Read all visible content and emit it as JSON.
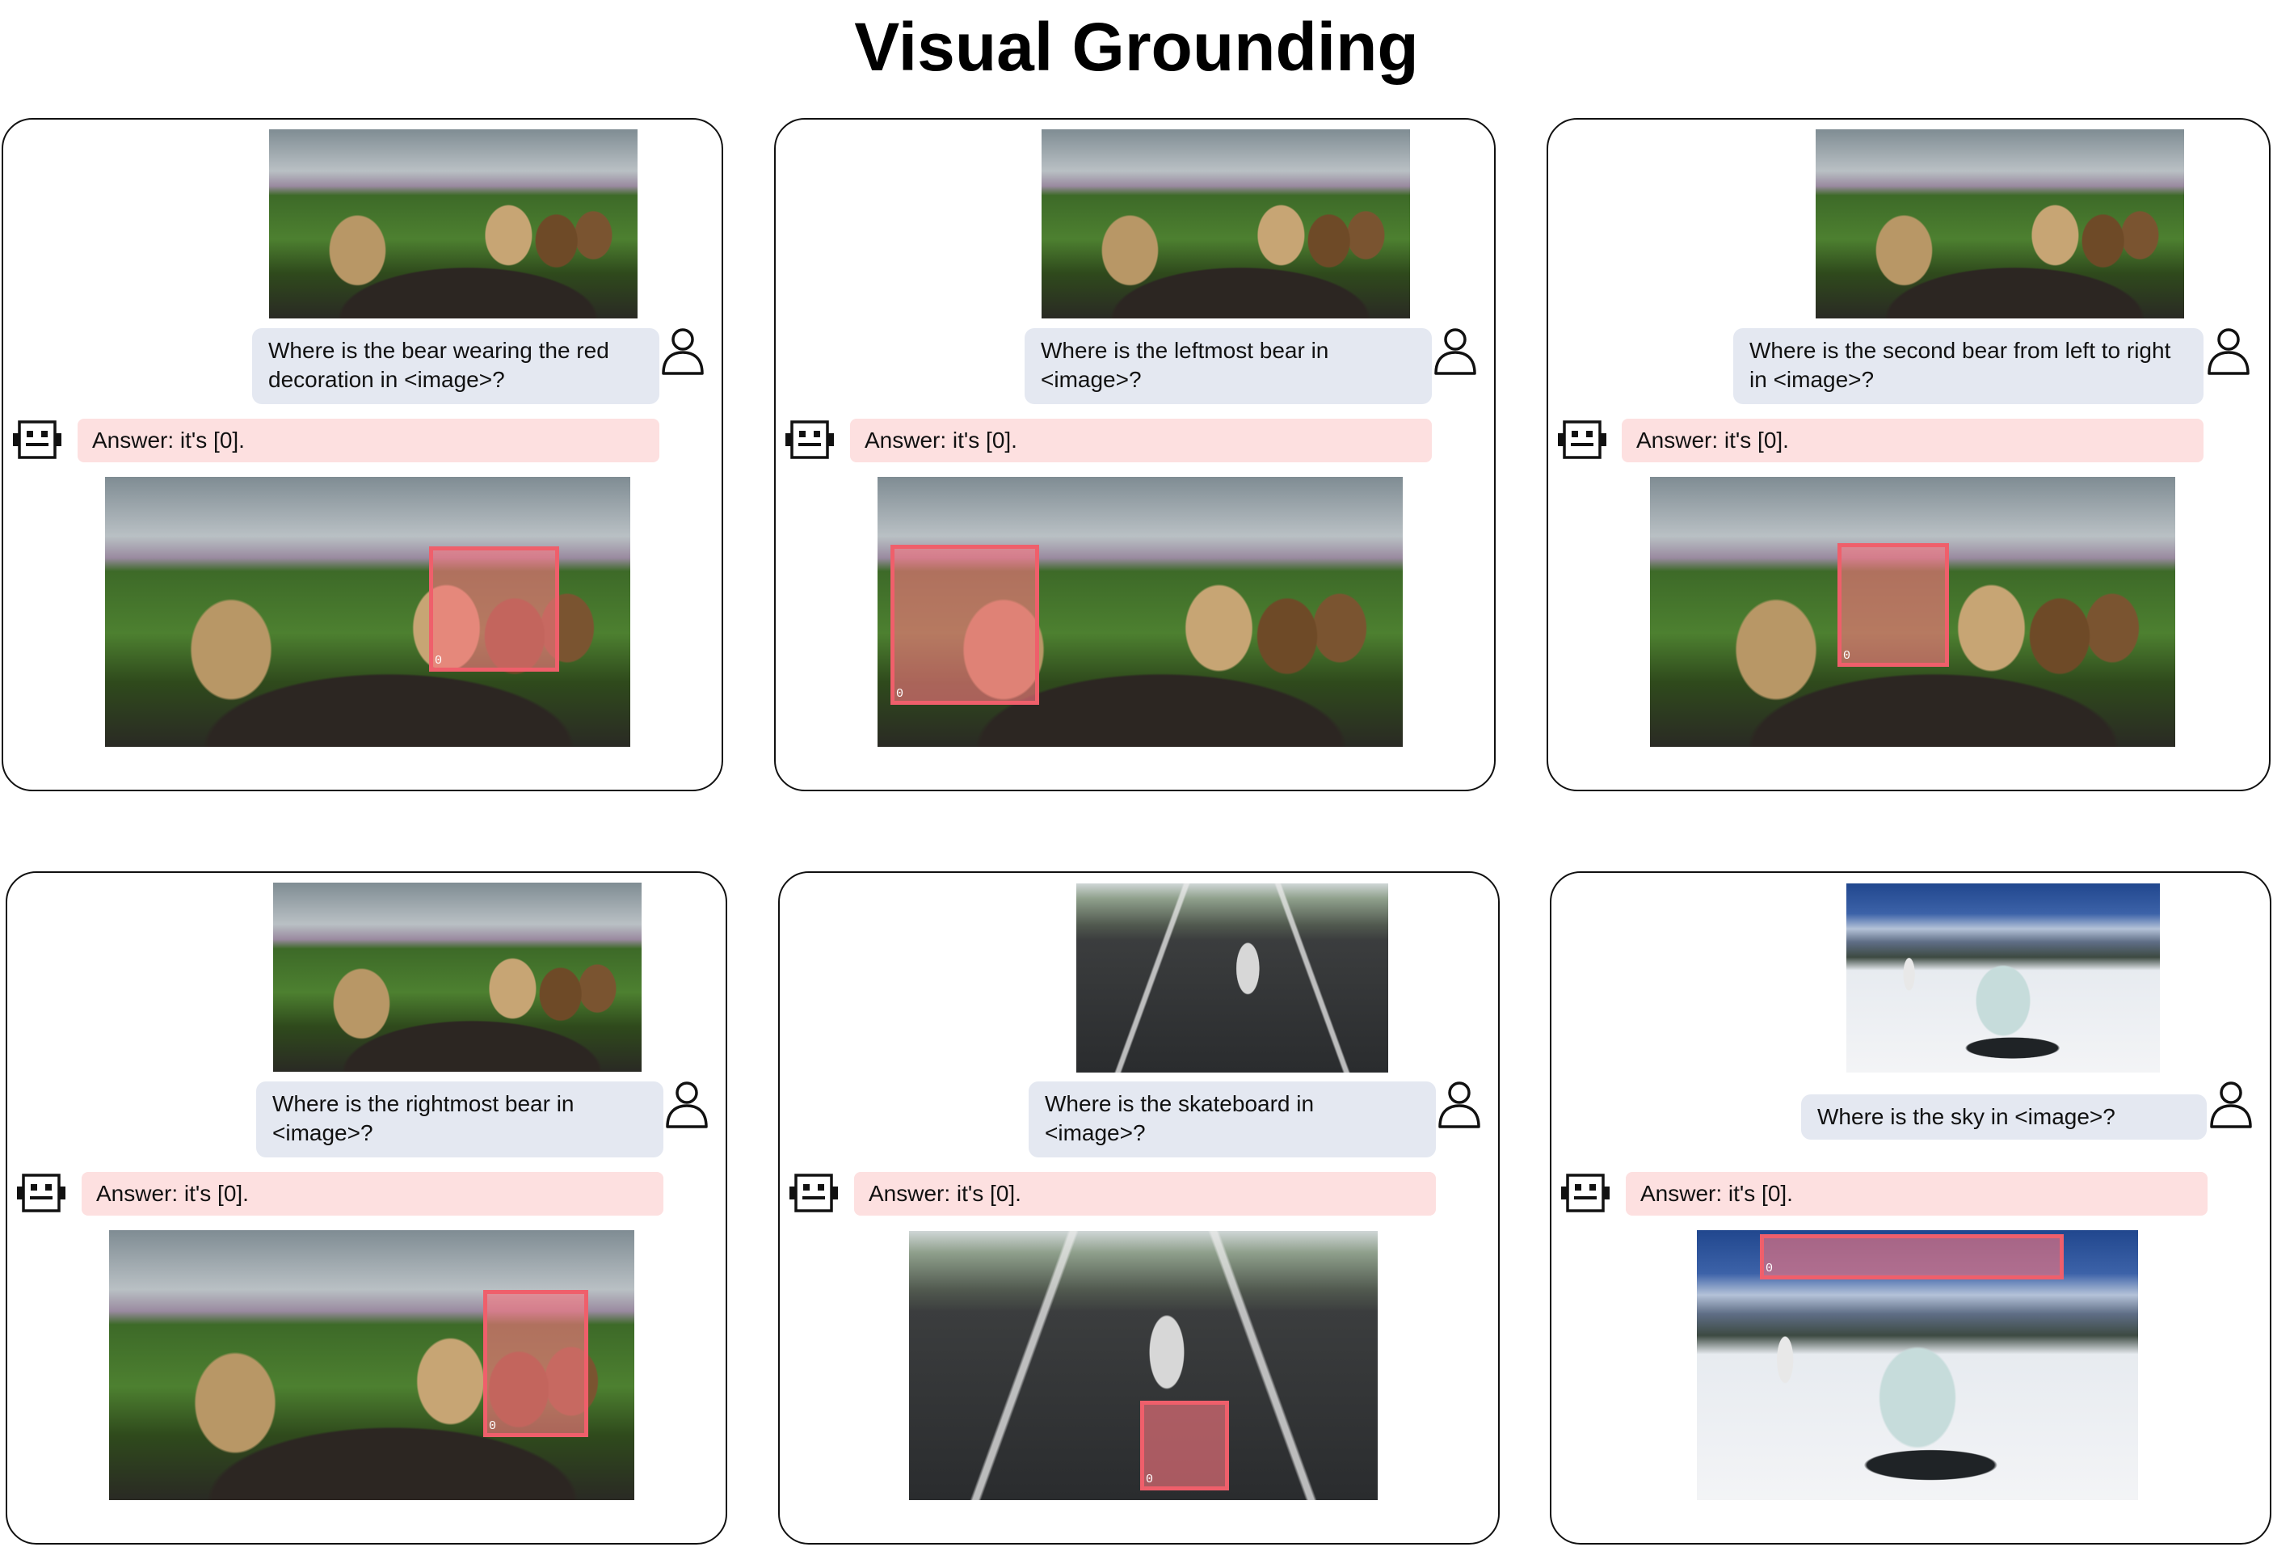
{
  "title": "Visual Grounding",
  "colors": {
    "question_bg": "#e4e8f1",
    "answer_bg": "#fde0e0",
    "box": "#ef5f6b"
  },
  "icons": {
    "user": "user-icon",
    "model": "robot-icon"
  },
  "panels": [
    {
      "question": "Where is the bear wearing the red decoration in <image>?",
      "answer": "Answer: it's [0].",
      "box_label": "0"
    },
    {
      "question": "Where is the leftmost bear in <image>?",
      "answer": "Answer: it's [0].",
      "box_label": "0"
    },
    {
      "question": "Where is the second bear from left to right in <image>?",
      "answer": "Answer: it's [0].",
      "box_label": "0"
    },
    {
      "question": "Where is the rightmost bear in <image>?",
      "answer": "Answer: it's [0].",
      "box_label": "0"
    },
    {
      "question": "Where is the skateboard in <image>?",
      "answer": "Answer: it's [0].",
      "box_label": "0"
    },
    {
      "question": "Where is the sky in <image>?",
      "answer": "Answer: it's [0].",
      "box_label": "0"
    }
  ]
}
